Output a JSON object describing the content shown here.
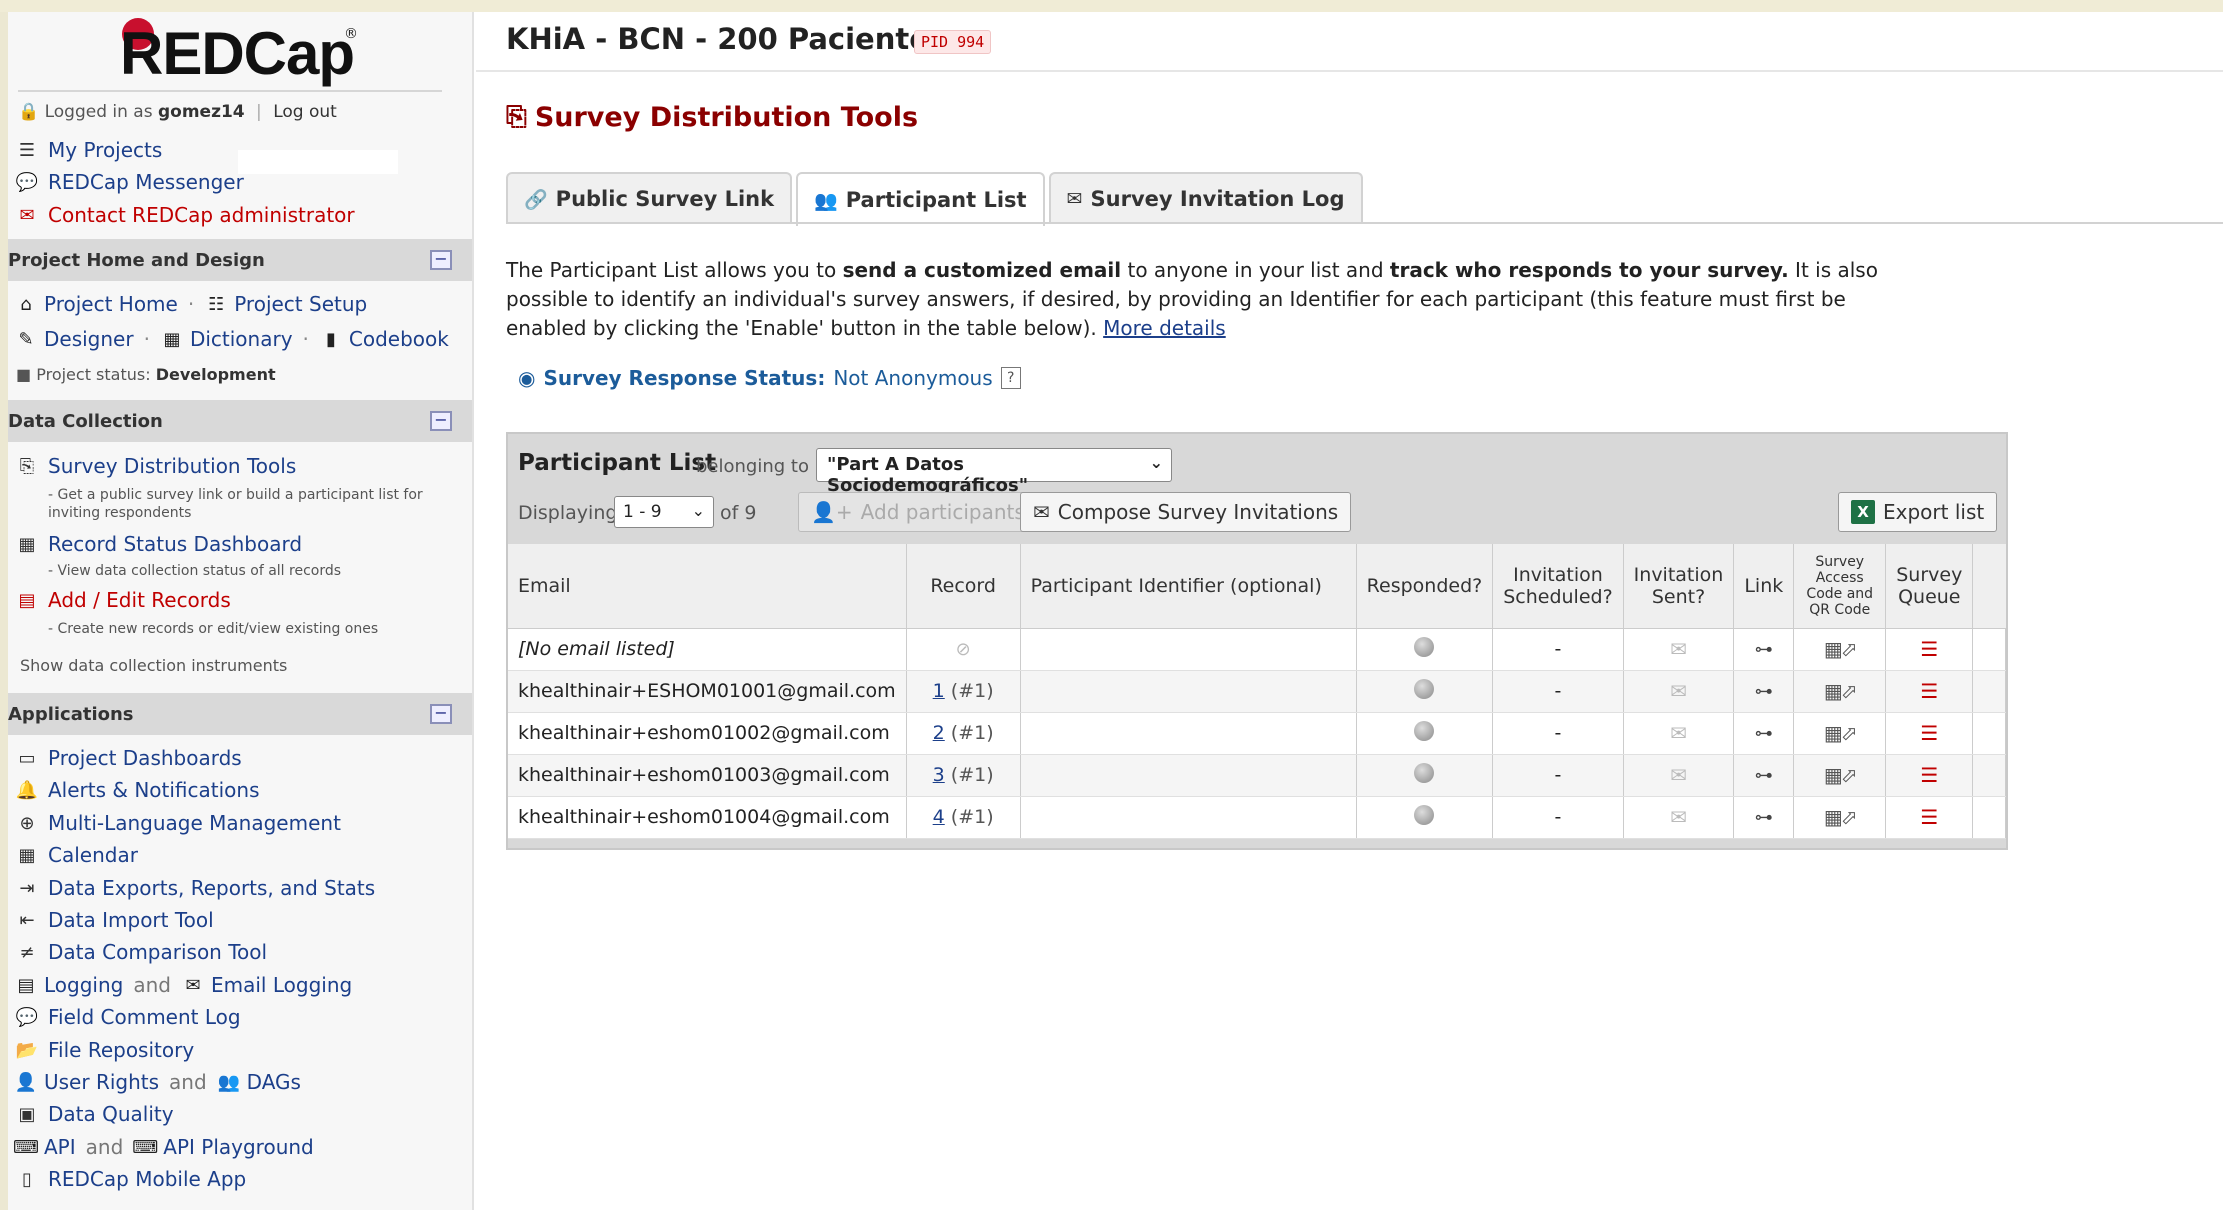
{
  "app": {
    "logo_text": "REDCap",
    "logo_reg": "®"
  },
  "login": {
    "prefix": "Logged in as",
    "user": "gomez14",
    "logout": "Log out"
  },
  "top_links": [
    {
      "label": "My Projects",
      "icon": "list-icon"
    },
    {
      "label": "REDCap Messenger",
      "icon": "chat-icon"
    },
    {
      "label": "Contact REDCap administrator",
      "icon": "envelope-icon"
    }
  ],
  "sections": {
    "project_home": {
      "title": "Project Home and Design",
      "project_home": "Project Home",
      "project_setup": "Project Setup",
      "designer": "Designer",
      "dictionary": "Dictionary",
      "codebook": "Codebook",
      "status_label": "Project status:",
      "status_value": "Development"
    },
    "data_collection": {
      "title": "Data Collection",
      "items": [
        {
          "label": "Survey Distribution Tools",
          "desc": "- Get a public survey link or build a participant list for inviting respondents"
        },
        {
          "label": "Record Status Dashboard",
          "desc": "- View data collection status of all records"
        },
        {
          "label": "Add / Edit Records",
          "desc": "- Create new records or edit/view existing ones"
        }
      ],
      "show_instruments": "Show data collection instruments"
    },
    "applications": {
      "title": "Applications",
      "project_dashboards": "Project Dashboards",
      "alerts": "Alerts & Notifications",
      "multilang": "Multi-Language Management",
      "calendar": "Calendar",
      "data_exports": "Data Exports, Reports, and Stats",
      "data_import": "Data Import Tool",
      "data_comparison": "Data Comparison Tool",
      "logging": "Logging",
      "and": "and",
      "email_logging": "Email Logging",
      "field_comment": "Field Comment Log",
      "file_repo": "File Repository",
      "user_rights": "User Rights",
      "dags": "DAGs",
      "data_quality": "Data Quality",
      "api": "API",
      "api_playground": "API Playground",
      "mobile_app": "REDCap Mobile App"
    }
  },
  "main": {
    "project_title": "KHiA - BCN - 200 Pacientes",
    "pid": "PID 994",
    "page_title": "Survey Distribution Tools",
    "tabs": [
      {
        "label": "Public Survey Link",
        "icon": "link-icon"
      },
      {
        "label": "Participant List",
        "icon": "users-icon",
        "active": true
      },
      {
        "label": "Survey Invitation Log",
        "icon": "envelope-log-icon"
      }
    ],
    "intro": {
      "p1": "The Participant List allows you to ",
      "b1": "send a customized email",
      "p2": " to anyone in your list and ",
      "b2": "track who responds to your survey.",
      "p3": " It is also possible to identify an individual's survey answers, if desired, by providing an Identifier for each participant (this feature must first be enabled by clicking the 'Enable' button in the table below). ",
      "more": "More details"
    },
    "response_status": {
      "label": "Survey Response Status:",
      "value": "Not Anonymous",
      "help": "?"
    }
  },
  "panel": {
    "title": "Participant List",
    "belonging_to": "belonging to",
    "survey_selected": "\"Part A Datos Sociodemográficos\"",
    "displaying": "Displaying",
    "range_selected": "1 - 9",
    "of_total": "of 9",
    "add_participants": "Add participants",
    "compose": "Compose Survey Invitations",
    "export": "Export list",
    "columns": {
      "email": "Email",
      "record": "Record",
      "identifier": "Participant Identifier (optional)",
      "responded": "Responded?",
      "inv_sched": "Invitation Scheduled?",
      "inv_sent": "Invitation Sent?",
      "link": "Link",
      "access": "Survey Access Code and QR Code",
      "queue": "Survey Queue"
    },
    "rows": [
      {
        "email": "[No email listed]",
        "record": "",
        "record_num": "",
        "sched": "-"
      },
      {
        "email": "khealthinair+ESHOM01001@gmail.com",
        "record": "1",
        "record_num": "(#1)",
        "sched": "-"
      },
      {
        "email": "khealthinair+eshom01002@gmail.com",
        "record": "2",
        "record_num": "(#1)",
        "sched": "-"
      },
      {
        "email": "khealthinair+eshom01003@gmail.com",
        "record": "3",
        "record_num": "(#1)",
        "sched": "-"
      },
      {
        "email": "khealthinair+eshom01004@gmail.com",
        "record": "4",
        "record_num": "(#1)",
        "sched": "-"
      }
    ]
  },
  "colors": {
    "brand_red": "#c8102e",
    "link_blue": "#1c3f8a",
    "title_red": "#8b0000"
  }
}
